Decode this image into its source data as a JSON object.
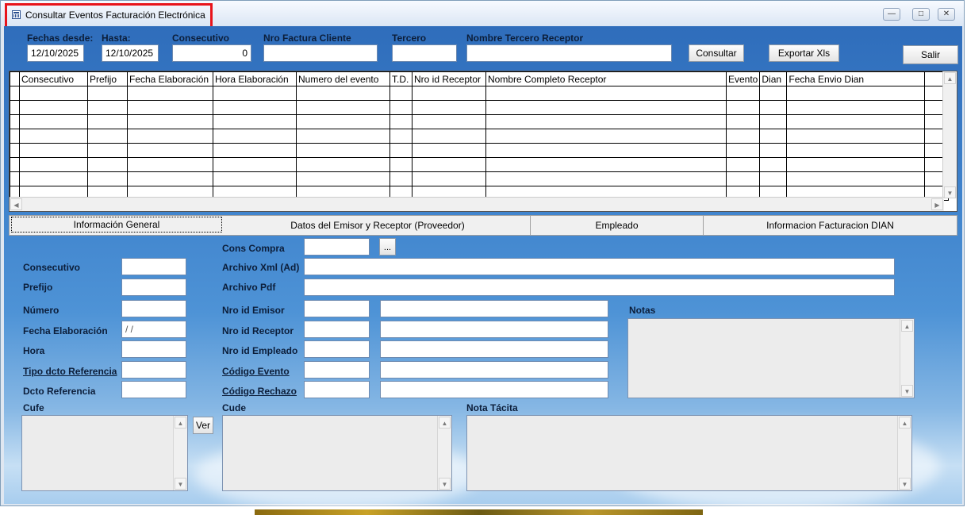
{
  "window": {
    "title": "Consultar Eventos Facturación Electrónica",
    "minimize_icon": "minimize-icon",
    "maximize_icon": "maximize-icon",
    "close_icon": "close-icon"
  },
  "filters": {
    "fechas_desde_label": "Fechas desde:",
    "fechas_desde_value": "12/10/2025",
    "hasta_label": "Hasta:",
    "hasta_value": "12/10/2025",
    "consecutivo_label": "Consecutivo",
    "consecutivo_value": "0",
    "nro_factura_label": "Nro Factura Cliente",
    "nro_factura_value": "",
    "tercero_label": "Tercero",
    "tercero_value": "",
    "nombre_tercero_label": "Nombre Tercero Receptor",
    "nombre_tercero_value": "",
    "consultar_label": "Consultar",
    "exportar_label": "Exportar Xls",
    "salir_label": "Salir"
  },
  "grid": {
    "columns": [
      "Consecutivo",
      "Prefijo",
      "Fecha Elaboración",
      "Hora Elaboración",
      "Numero del evento",
      "T.D.",
      "Nro id Receptor",
      "Nombre Completo Receptor",
      "Evento",
      "Dian",
      "Fecha Envio Dian",
      ""
    ],
    "empty_rows": 8
  },
  "tabs": [
    "Información General",
    "Datos del Emisor y Receptor (Proveedor)",
    "Empleado",
    "Informacion Facturacion DIAN"
  ],
  "general": {
    "consecutivo_label": "Consecutivo",
    "prefijo_label": "Prefijo",
    "numero_label": "Número",
    "fecha_elab_label": "Fecha Elaboración",
    "fecha_elab_value": " /  /",
    "hora_label": "Hora",
    "tipo_dcto_label": "Tipo dcto Referencia",
    "dcto_ref_label": "Dcto Referencia",
    "cons_compra_label": "Cons Compra",
    "cons_compra_btn": "...",
    "archivo_xml_label": "Archivo Xml (Ad)",
    "archivo_pdf_label": "Archivo Pdf",
    "nro_id_emisor_label": "Nro id Emisor",
    "nro_id_receptor_label": "Nro id Receptor",
    "nro_id_empleado_label": "Nro id Empleado",
    "codigo_evento_label": "Código Evento",
    "codigo_rechazo_label": "Código Rechazo",
    "notas_label": "Notas",
    "cufe_label": "Cufe",
    "ver_label": "Ver",
    "cude_label": "Cude",
    "nota_tacita_label": "Nota Tácita"
  }
}
